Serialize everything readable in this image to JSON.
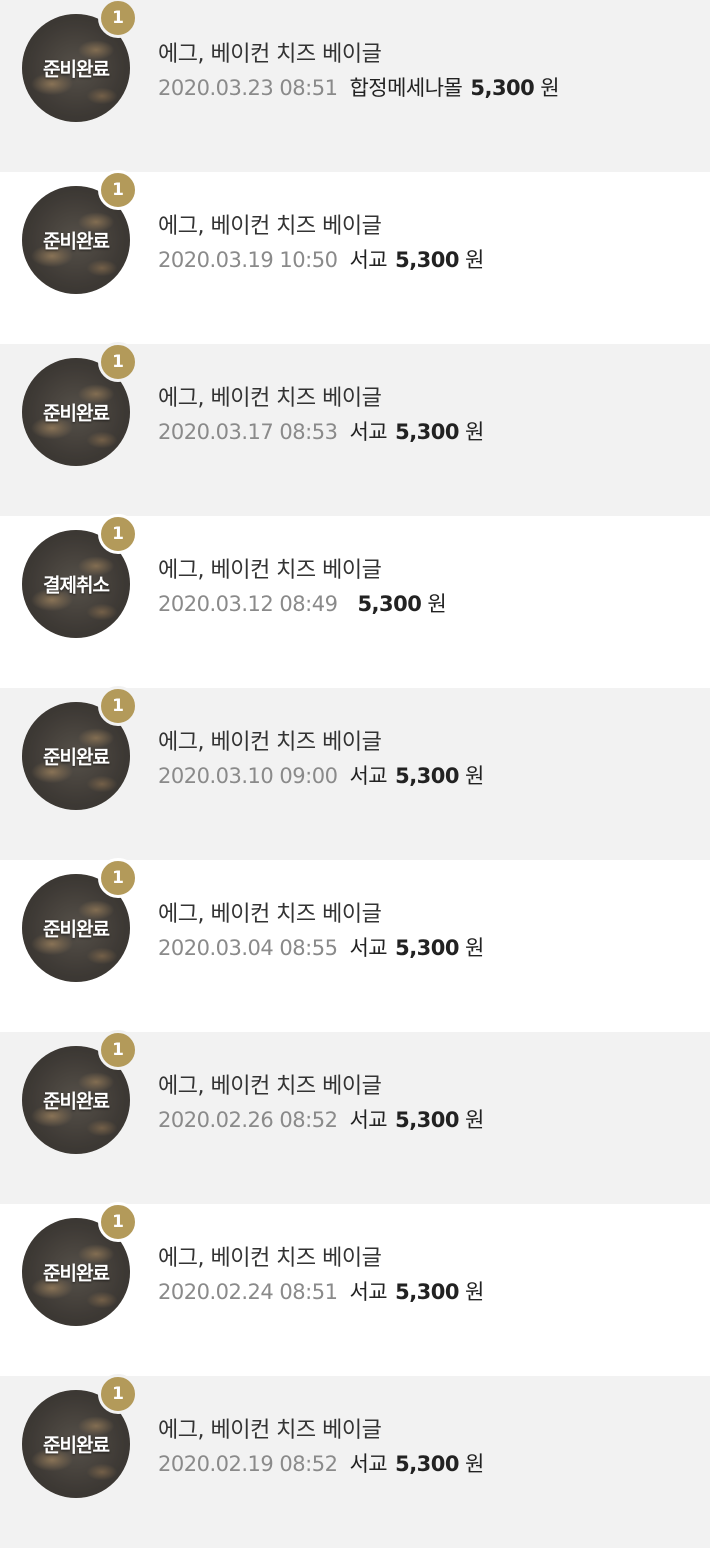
{
  "orders": [
    {
      "status": "준비완료",
      "count": "1",
      "product": "에그, 베이컨 치즈 베이글",
      "date": "2020.03.23 08:51",
      "store": "합정메세나몰",
      "price": "5,300",
      "currency": "원"
    },
    {
      "status": "준비완료",
      "count": "1",
      "product": "에그, 베이컨 치즈 베이글",
      "date": "2020.03.19 10:50",
      "store": "서교",
      "price": "5,300",
      "currency": "원"
    },
    {
      "status": "준비완료",
      "count": "1",
      "product": "에그, 베이컨 치즈 베이글",
      "date": "2020.03.17 08:53",
      "store": "서교",
      "price": "5,300",
      "currency": "원"
    },
    {
      "status": "결제취소",
      "count": "1",
      "product": "에그, 베이컨 치즈 베이글",
      "date": "2020.03.12 08:49",
      "store": "",
      "price": "5,300",
      "currency": "원"
    },
    {
      "status": "준비완료",
      "count": "1",
      "product": "에그, 베이컨 치즈 베이글",
      "date": "2020.03.10 09:00",
      "store": "서교",
      "price": "5,300",
      "currency": "원"
    },
    {
      "status": "준비완료",
      "count": "1",
      "product": "에그, 베이컨 치즈 베이글",
      "date": "2020.03.04 08:55",
      "store": "서교",
      "price": "5,300",
      "currency": "원"
    },
    {
      "status": "준비완료",
      "count": "1",
      "product": "에그, 베이컨 치즈 베이글",
      "date": "2020.02.26 08:52",
      "store": "서교",
      "price": "5,300",
      "currency": "원"
    },
    {
      "status": "준비완료",
      "count": "1",
      "product": "에그, 베이컨 치즈 베이글",
      "date": "2020.02.24 08:51",
      "store": "서교",
      "price": "5,300",
      "currency": "원"
    },
    {
      "status": "준비완료",
      "count": "1",
      "product": "에그, 베이컨 치즈 베이글",
      "date": "2020.02.19 08:52",
      "store": "서교",
      "price": "5,300",
      "currency": "원"
    }
  ],
  "colors": {
    "row_alt_background": "#f2f2f2",
    "row_plain_background": "#ffffff",
    "badge": "#b39a5a",
    "date_text": "#8a8a8a"
  }
}
